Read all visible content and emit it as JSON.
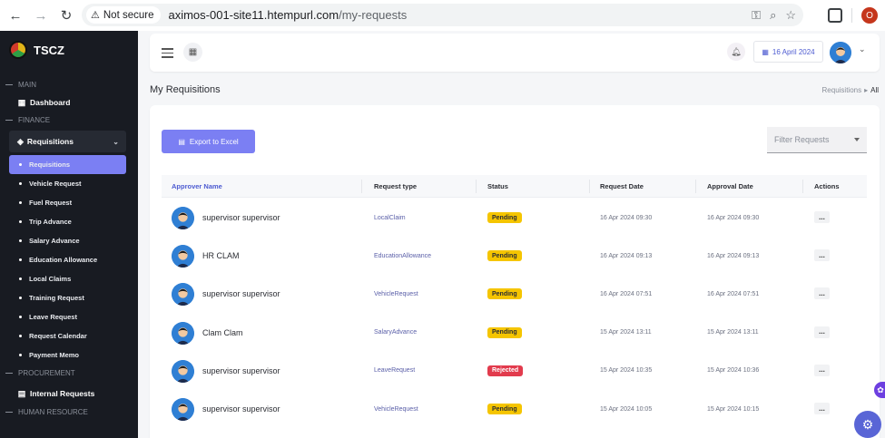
{
  "browser": {
    "security_label": "Not secure",
    "url_host": "aximos-001-site11.htempurl.com",
    "url_path": "/my-requests",
    "profile_initial": "O"
  },
  "sidebar": {
    "brand": "TSCZ",
    "sections": {
      "main": "MAIN",
      "finance": "FINANCE",
      "procurement": "PROCUREMENT",
      "human_resource": "HUMAN RESOURCE"
    },
    "dashboard": "Dashboard",
    "requisitions_group": "Requisitions",
    "sub_items": [
      "Requisitions",
      "Vehicle Request",
      "Fuel Request",
      "Trip Advance",
      "Salary Advance",
      "Education Allowance",
      "Local Claims",
      "Training Request",
      "Leave Request",
      "Request Calendar",
      "Payment Memo"
    ],
    "internal_requests": "Internal Requests"
  },
  "header": {
    "date": "16 April 2024"
  },
  "page": {
    "title": "My Requisitions",
    "breadcrumb_parent": "Requisitions",
    "breadcrumb_current": "All"
  },
  "toolbar": {
    "export_label": "Export to Excel",
    "filter_placeholder": "Filter Requests"
  },
  "table": {
    "columns": [
      "Approver Name",
      "Request type",
      "Status",
      "Request Date",
      "Approval Date",
      "Actions"
    ],
    "rows": [
      {
        "name": "supervisor supervisor",
        "type": "LocalClaim",
        "status": "Pending",
        "request_date": "16 Apr 2024 09:30",
        "approval_date": "16 Apr 2024 09:30",
        "action": "..."
      },
      {
        "name": "HR CLAM",
        "type": "EducationAllowance",
        "status": "Pending",
        "request_date": "16 Apr 2024 09:13",
        "approval_date": "16 Apr 2024 09:13",
        "action": "..."
      },
      {
        "name": "supervisor supervisor",
        "type": "VehicleRequest",
        "status": "Pending",
        "request_date": "16 Apr 2024 07:51",
        "approval_date": "16 Apr 2024 07:51",
        "action": "..."
      },
      {
        "name": "Clam Clam",
        "type": "SalaryAdvance",
        "status": "Pending",
        "request_date": "15 Apr 2024 13:11",
        "approval_date": "15 Apr 2024 13:11",
        "action": "..."
      },
      {
        "name": "supervisor supervisor",
        "type": "LeaveRequest",
        "status": "Rejected",
        "request_date": "15 Apr 2024 10:35",
        "approval_date": "15 Apr 2024 10:36",
        "action": "..."
      },
      {
        "name": "supervisor supervisor",
        "type": "VehicleRequest",
        "status": "Pending",
        "request_date": "15 Apr 2024 10:05",
        "approval_date": "15 Apr 2024 10:15",
        "action": "..."
      }
    ]
  },
  "colors": {
    "accent": "#7b7ff3",
    "sidebar_bg": "#181b22",
    "pending": "#f5c500",
    "rejected": "#e23b4d"
  }
}
